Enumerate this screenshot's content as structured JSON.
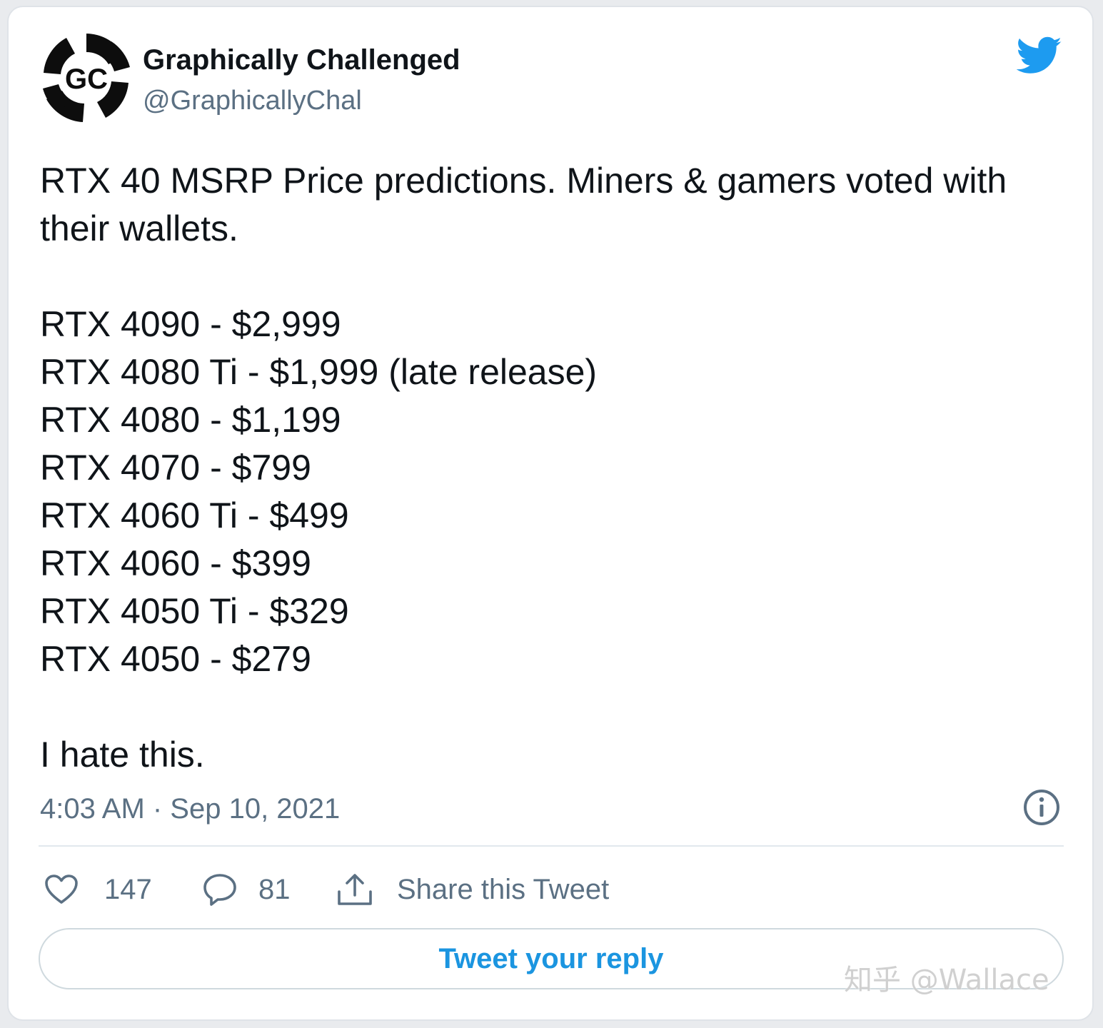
{
  "author": {
    "display_name": "Graphically Challenged",
    "handle": "@GraphicallyChal",
    "avatar_text": "GC"
  },
  "tweet": {
    "intro": "RTX 40 MSRP Price predictions. Miners & gamers voted with their wallets.",
    "price_lines": [
      "RTX 4090 - $2,999",
      "RTX 4080 Ti - $1,999 (late release)",
      "RTX 4080 - $1,199",
      "RTX 4070 - $799",
      "RTX 4060 Ti - $499",
      "RTX 4060 - $399",
      "RTX 4050 Ti - $329",
      "RTX 4050 - $279"
    ],
    "closing": "I hate this.",
    "timestamp": "4:03 AM · Sep 10, 2021"
  },
  "actions": {
    "like_count": "147",
    "reply_count": "81",
    "share_label": "Share this Tweet"
  },
  "reply_button_label": "Tweet your reply",
  "watermark": "知乎 @Wallace",
  "icons": {
    "brand": "twitter-bird-icon",
    "info": "info-icon",
    "like": "heart-icon",
    "reply": "speech-bubble-icon",
    "share": "share-upload-icon"
  },
  "colors": {
    "twitter_blue": "#1d9bf0",
    "link_blue": "#1b95e0",
    "secondary_text": "#5b7083",
    "primary_text": "#0f1419"
  }
}
